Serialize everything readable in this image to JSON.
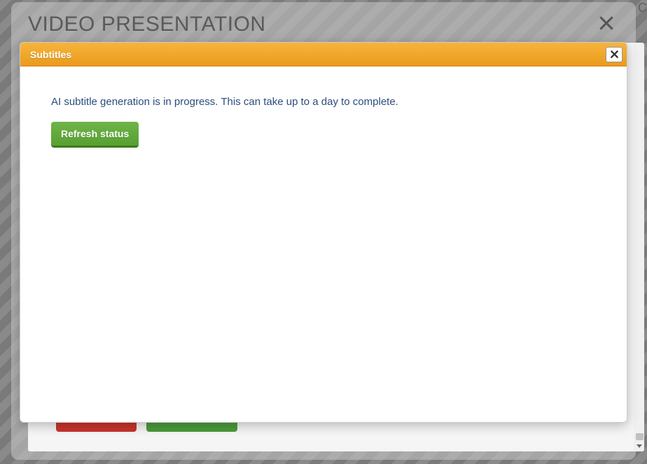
{
  "outer": {
    "title": "VIDEO PRESENTATION"
  },
  "dialog": {
    "title": "Subtitles",
    "status_text": "AI subtitle generation is in progress. This can take up to a day to complete.",
    "refresh_label": "Refresh status"
  }
}
